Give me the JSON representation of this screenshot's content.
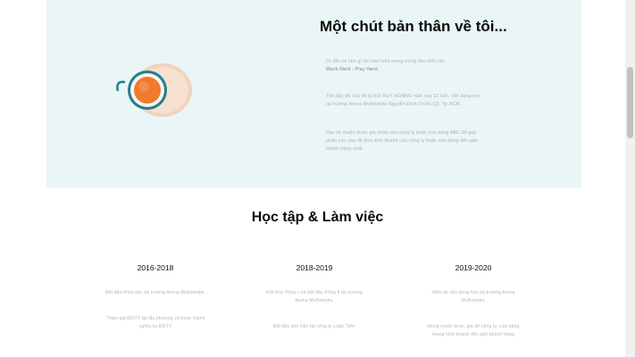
{
  "about": {
    "title": "Một chút bản thân về tôi...",
    "para1": "Dí dâu và làm gì tôi luôn luôn mang trong đầu một câu:",
    "motto": "Work Hard - Play Hard.",
    "para2": "Tên đầy đủ của tôi là BÙI HUY HOÀNG năm nay 23 tuổi, vẫn đang học tại trường Arena Multimedia Nguyễn Đình Chiểu Q3, Tp HCM.",
    "para3": "Hay tôi muốn được gia nhập vào công ty hoặc cửa hàng ABC để góp phần cực nay để đưa kinh doanh của công ty hoặc cửa hàng đến gần khách hàng nhất."
  },
  "section": {
    "title": "Học tập & Làm việc"
  },
  "timeline": [
    {
      "year": "2016-2018",
      "desc1": "Bắt đầu khóa học tại trường Arena Multimedia.",
      "desc2": "Tham gia ĐGTV tại địa phương và hoàn thành nghĩa vụ ĐGTV"
    },
    {
      "year": "2018-2019",
      "desc1": "Kết thúc Khóa I và bắt đầu Khóa II tại trường Arena Multimedia.",
      "desc2": "Bắt đầu làm việc tại công ty Luận Tiến."
    },
    {
      "year": "2019-2020",
      "desc1": "Hiện tại vẫn đang học tại trường Arena Multimedia.",
      "desc2": "Mong muốn được gia để công ty, cửa hàng mang kinh doanh đến gần khách hàng"
    }
  ],
  "colors": {
    "about_bg": "#e9f6f5",
    "cup": "#f07a2d",
    "plate": "#f2d2be",
    "cup_rim": "#1f7f8f"
  },
  "icons": {
    "about_image": "coffee-cup-icon"
  }
}
